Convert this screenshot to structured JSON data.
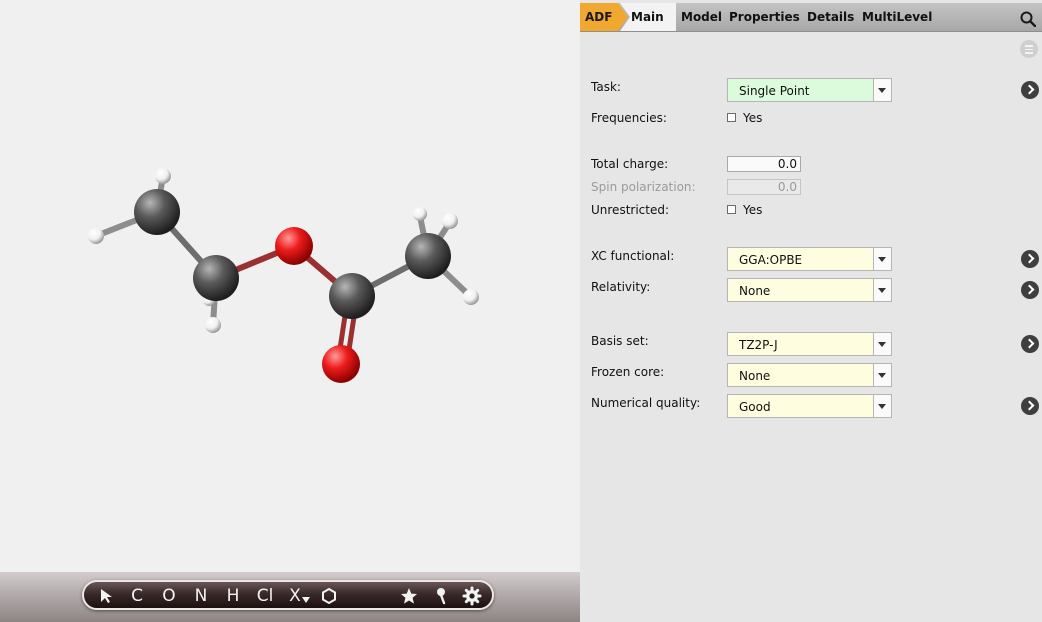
{
  "toolbar": {
    "tools": [
      "",
      "C",
      "O",
      "N",
      "H",
      "Cl",
      "X",
      "",
      "",
      "",
      ""
    ],
    "icons": [
      "pointer-arrow-icon",
      "ring-icon",
      "star-icon",
      "pin-icon",
      "gear-icon"
    ]
  },
  "tabs": {
    "adf": "ADF",
    "main": "Main",
    "items": [
      "Model",
      "Properties",
      "Details",
      "MultiLevel"
    ]
  },
  "form": {
    "task_label": "Task:",
    "task_value": "Single Point",
    "frequencies_label": "Frequencies:",
    "frequencies_option": "Yes",
    "total_charge_label": "Total charge:",
    "total_charge_value": "0.0",
    "spin_label": "Spin polarization:",
    "spin_value": "0.0",
    "unrestricted_label": "Unrestricted:",
    "unrestricted_option": "Yes",
    "xc_label": "XC functional:",
    "xc_value": "GGA:OPBE",
    "relativity_label": "Relativity:",
    "relativity_value": "None",
    "basis_label": "Basis set:",
    "basis_value": "TZ2P-J",
    "frozen_label": "Frozen core:",
    "frozen_value": "None",
    "quality_label": "Numerical quality:",
    "quality_value": "Good"
  },
  "colors": {
    "accent": "#f0a830",
    "task_bg": "#dbfbdc",
    "combo_bg": "#fffddf",
    "carbon": "#4a4a4a",
    "oxygen": "#e01818",
    "hydrogen": "#ffffff"
  }
}
